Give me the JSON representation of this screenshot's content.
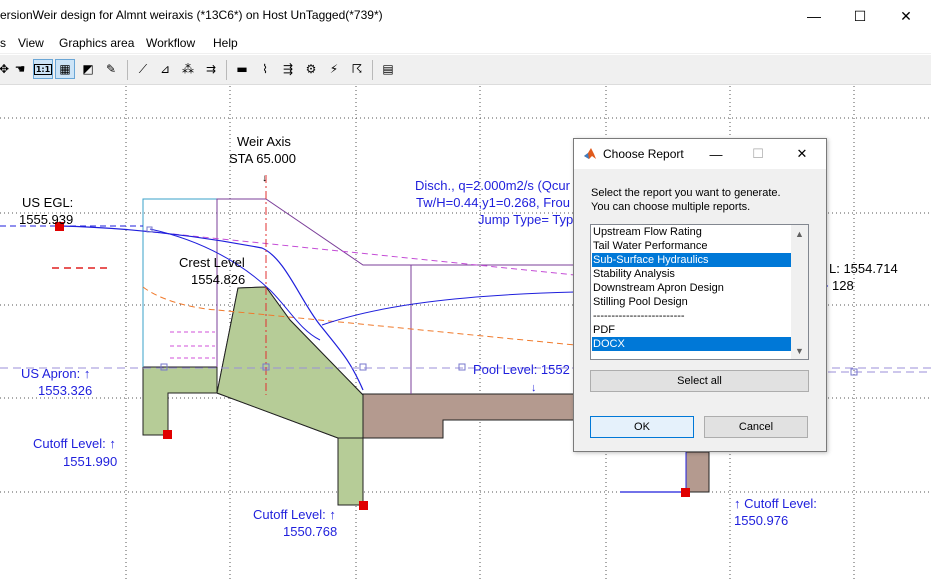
{
  "window": {
    "title": "ersionWeir design for Almnt weiraxis (*13C6*) on Host UnTagged(*739*)",
    "minimize": "—",
    "maximize": "☐",
    "close": "✕"
  },
  "menu": {
    "items": [
      "s",
      "View",
      "Graphics area",
      "Workflow",
      "Help"
    ]
  },
  "toolbar": {
    "buttons": [
      "pan-icon",
      "hand-icon",
      "one-to-one-icon",
      "grid-icon",
      "zoom-extents-icon",
      "edit-icon",
      "section-icon",
      "profile-icon",
      "points-icon",
      "export-icon",
      "ruler-icon",
      "shape-icon",
      "flow-icon",
      "settings-icon",
      "hydraulic-icon",
      "chart-icon",
      "report-icon"
    ],
    "one_to_one_label": "1:1"
  },
  "drawing": {
    "weir_axis": "Weir Axis",
    "weir_sta": "STA 65.000",
    "us_egl_label": "US EGL:",
    "us_egl_value": "1555.939",
    "crest_label": "Crest Level",
    "crest_value": "1554.826",
    "disch_line1": "Disch., q=2.000m2/s (Qcur",
    "disch_line2": "Tw/H=0.44,y1=0.268, Frou",
    "disch_line3": "Jump Type= Typ",
    "ds_egl_value_a": "L: 1554.714",
    "ds_egl_value_b": "128",
    "us_apron_label": "US Apron: ↑",
    "us_apron_value": "1553.326",
    "pool_level_label": "Pool Level: 1552",
    "cutoff1_label": "Cutoff Level: ↑",
    "cutoff1_value": "1551.990",
    "cutoff2_label": "Cutoff Level: ↑",
    "cutoff2_value": "1550.768",
    "cutoff3_label": "↑ Cutoff Level:",
    "cutoff3_value": "1550.976"
  },
  "dialog": {
    "title": "Choose Report",
    "instruction_line1": "Select the report you want to generate.",
    "instruction_line2": "You can choose multiple reports.",
    "items": [
      {
        "label": "Upstream Flow Rating",
        "selected": false
      },
      {
        "label": "Tail Water Performance",
        "selected": false
      },
      {
        "label": "Sub-Surface Hydraulics",
        "selected": true
      },
      {
        "label": "Stability Analysis",
        "selected": false
      },
      {
        "label": "Downstream Apron Design",
        "selected": false
      },
      {
        "label": "Stilling Pool Design",
        "selected": false
      },
      {
        "label": "-------------------------",
        "selected": false
      },
      {
        "label": "PDF",
        "selected": false
      },
      {
        "label": "DOCX",
        "selected": true
      }
    ],
    "select_all": "Select all",
    "ok": "OK",
    "cancel": "Cancel",
    "minimize": "—",
    "maximize": "☐",
    "close": "✕"
  },
  "colors": {
    "label_blue": "#1f1fdc",
    "weir_green": "#b6cc97",
    "apron_brown": "#b49a8f",
    "selection": "#0078d7"
  }
}
